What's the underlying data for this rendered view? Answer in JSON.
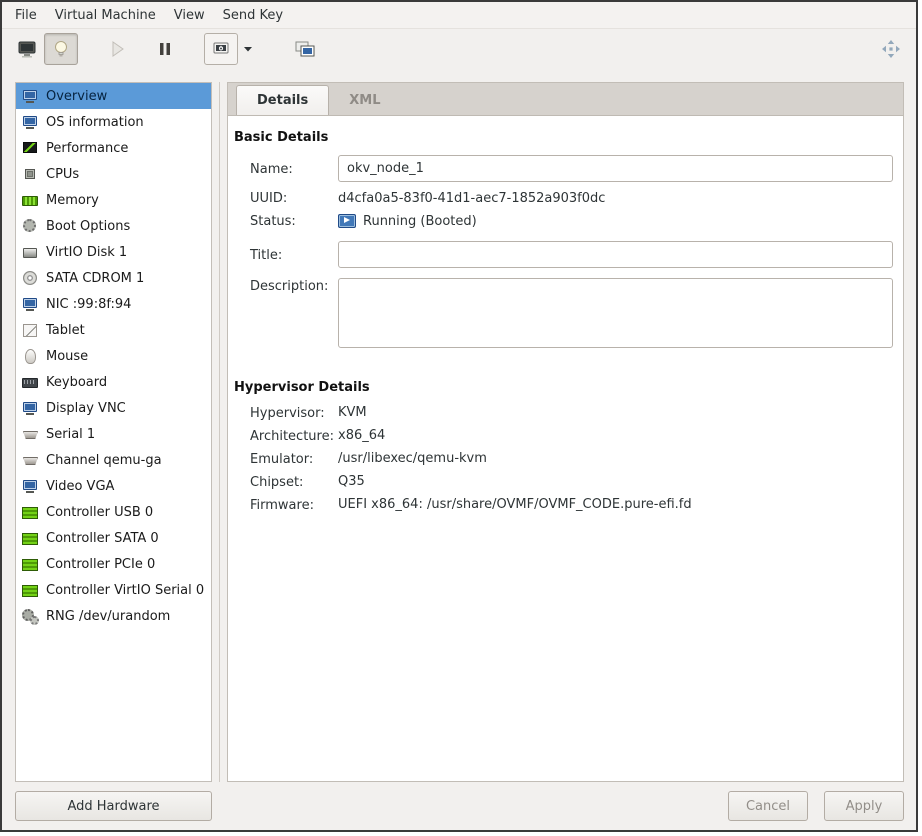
{
  "menubar": {
    "items": [
      "File",
      "Virtual Machine",
      "View",
      "Send Key"
    ]
  },
  "toolbar": {
    "icons": [
      "console-icon",
      "lightbulb-icon",
      "play-icon",
      "pause-icon",
      "shutdown-icon",
      "caret-down-icon",
      "dual-display-icon",
      "move-arrows-icon"
    ]
  },
  "sidebar": {
    "items": [
      {
        "label": "Overview",
        "icon": "monitor-icon",
        "selected": true
      },
      {
        "label": "OS information",
        "icon": "monitor-icon"
      },
      {
        "label": "Performance",
        "icon": "performance-icon"
      },
      {
        "label": "CPUs",
        "icon": "cpu-icon"
      },
      {
        "label": "Memory",
        "icon": "memory-icon"
      },
      {
        "label": "Boot Options",
        "icon": "gear-icon"
      },
      {
        "label": "VirtIO Disk 1",
        "icon": "disk-icon"
      },
      {
        "label": "SATA CDROM 1",
        "icon": "cdrom-icon"
      },
      {
        "label": "NIC :99:8f:94",
        "icon": "network-icon"
      },
      {
        "label": "Tablet",
        "icon": "tablet-icon"
      },
      {
        "label": "Mouse",
        "icon": "mouse-icon"
      },
      {
        "label": "Keyboard",
        "icon": "keyboard-icon"
      },
      {
        "label": "Display VNC",
        "icon": "display-icon"
      },
      {
        "label": "Serial 1",
        "icon": "serial-icon"
      },
      {
        "label": "Channel qemu-ga",
        "icon": "channel-icon"
      },
      {
        "label": "Video VGA",
        "icon": "video-icon"
      },
      {
        "label": "Controller USB 0",
        "icon": "controller-icon"
      },
      {
        "label": "Controller SATA 0",
        "icon": "controller-icon"
      },
      {
        "label": "Controller PCIe 0",
        "icon": "controller-icon"
      },
      {
        "label": "Controller VirtIO Serial 0",
        "icon": "controller-icon"
      },
      {
        "label": "RNG /dev/urandom",
        "icon": "rng-icon"
      }
    ],
    "add_hardware_label": "Add Hardware"
  },
  "tabs": {
    "details": "Details",
    "xml": "XML"
  },
  "details": {
    "basic_title": "Basic Details",
    "name_label": "Name:",
    "name_value": "okv_node_1",
    "uuid_label": "UUID:",
    "uuid_value": "d4cfa0a5-83f0-41d1-aec7-1852a903f0dc",
    "status_label": "Status:",
    "status_icon": "running-icon",
    "status_value": "Running (Booted)",
    "title_label": "Title:",
    "title_value": "",
    "description_label": "Description:",
    "description_value": ""
  },
  "hypervisor": {
    "title": "Hypervisor Details",
    "rows": [
      {
        "label": "Hypervisor:",
        "value": "KVM"
      },
      {
        "label": "Architecture:",
        "value": "x86_64"
      },
      {
        "label": "Emulator:",
        "value": "/usr/libexec/qemu-kvm"
      },
      {
        "label": "Chipset:",
        "value": "Q35"
      },
      {
        "label": "Firmware:",
        "value": "UEFI x86_64: /usr/share/OVMF/OVMF_CODE.pure-efi.fd"
      }
    ]
  },
  "footer": {
    "cancel_label": "Cancel",
    "apply_label": "Apply"
  }
}
